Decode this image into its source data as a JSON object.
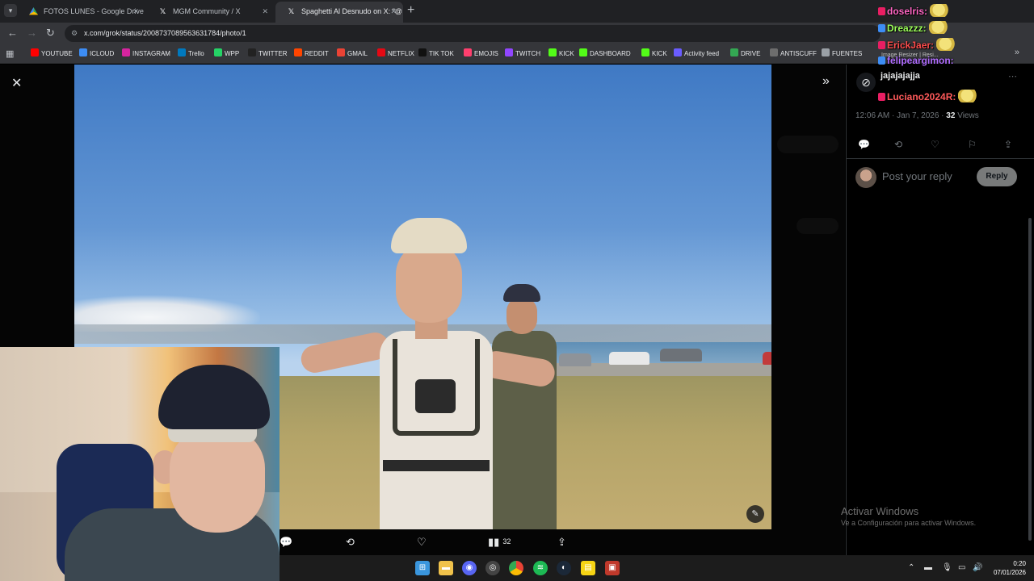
{
  "tabs": [
    {
      "title": "FOTOS LUNES - Google Drive",
      "icon": "google-drive-icon"
    },
    {
      "title": "MGM Community / X",
      "icon": "x-logo-icon"
    },
    {
      "title": "Spaghetti Al Desnudo on X: \"@",
      "icon": "x-logo-icon",
      "active": true
    }
  ],
  "address": {
    "url": "x.com/grok/status/2008737089563631784/photo/1"
  },
  "bookmarks": [
    {
      "label": "YOUTUBE",
      "color": "#ff0000"
    },
    {
      "label": "ICLOUD",
      "color": "#3d8df5"
    },
    {
      "label": "INSTAGRAM",
      "color": "#d6249f"
    },
    {
      "label": "Trello",
      "color": "#0079bf"
    },
    {
      "label": "WPP",
      "color": "#25d366"
    },
    {
      "label": "TWITTER",
      "color": "#222222"
    },
    {
      "label": "REDDIT",
      "color": "#ff4500"
    },
    {
      "label": "GMAIL",
      "color": "#ea4335"
    },
    {
      "label": "NETFLIX",
      "color": "#e50914"
    },
    {
      "label": "TIK TOK",
      "color": "#111111"
    },
    {
      "label": "EMOJIS",
      "color": "#ff3f6e"
    },
    {
      "label": "TWITCH",
      "color": "#9146ff"
    },
    {
      "label": "KICK",
      "color": "#53fc18"
    },
    {
      "label": "DASHBOARD",
      "color": "#53fc18"
    },
    {
      "label": "KICK",
      "color": "#53fc18"
    },
    {
      "label": "Activity feed",
      "color": "#6a5cff"
    },
    {
      "label": "DRIVE",
      "color": "#34a853"
    },
    {
      "label": "ANTISCUFF",
      "color": "#6d6d6d"
    },
    {
      "label": "FUENTES",
      "color": "#9aa0a6"
    }
  ],
  "viewer": {
    "actions": {
      "views": "32"
    }
  },
  "panel": {
    "header": "jajajajajja",
    "meta_time": "12:06 AM · Jan 7, 2026 · ",
    "meta_views": "32",
    "meta_views_label": " Views",
    "reply_placeholder": "Post your reply",
    "reply_button": "Reply"
  },
  "chat": {
    "lines": [
      {
        "user": "doselris:",
        "color": "#ff66c4"
      },
      {
        "user": "Dreazzz:",
        "color": "#9cff5a"
      },
      {
        "user": "ErickJaer:",
        "color": "#ff4d4d"
      },
      {
        "user": "felipeargimon:",
        "color": "#b06cff"
      },
      {
        "user": "Luciano2024R:",
        "color": "#ff5a5a"
      }
    ],
    "sub_text": "Image Resizer | Resi..."
  },
  "watermark": {
    "title": "Activar Windows",
    "subtitle": "Ve a Configuración para activar Windows."
  },
  "taskbar": {
    "time": "0:20",
    "date": "07/01/2026"
  }
}
